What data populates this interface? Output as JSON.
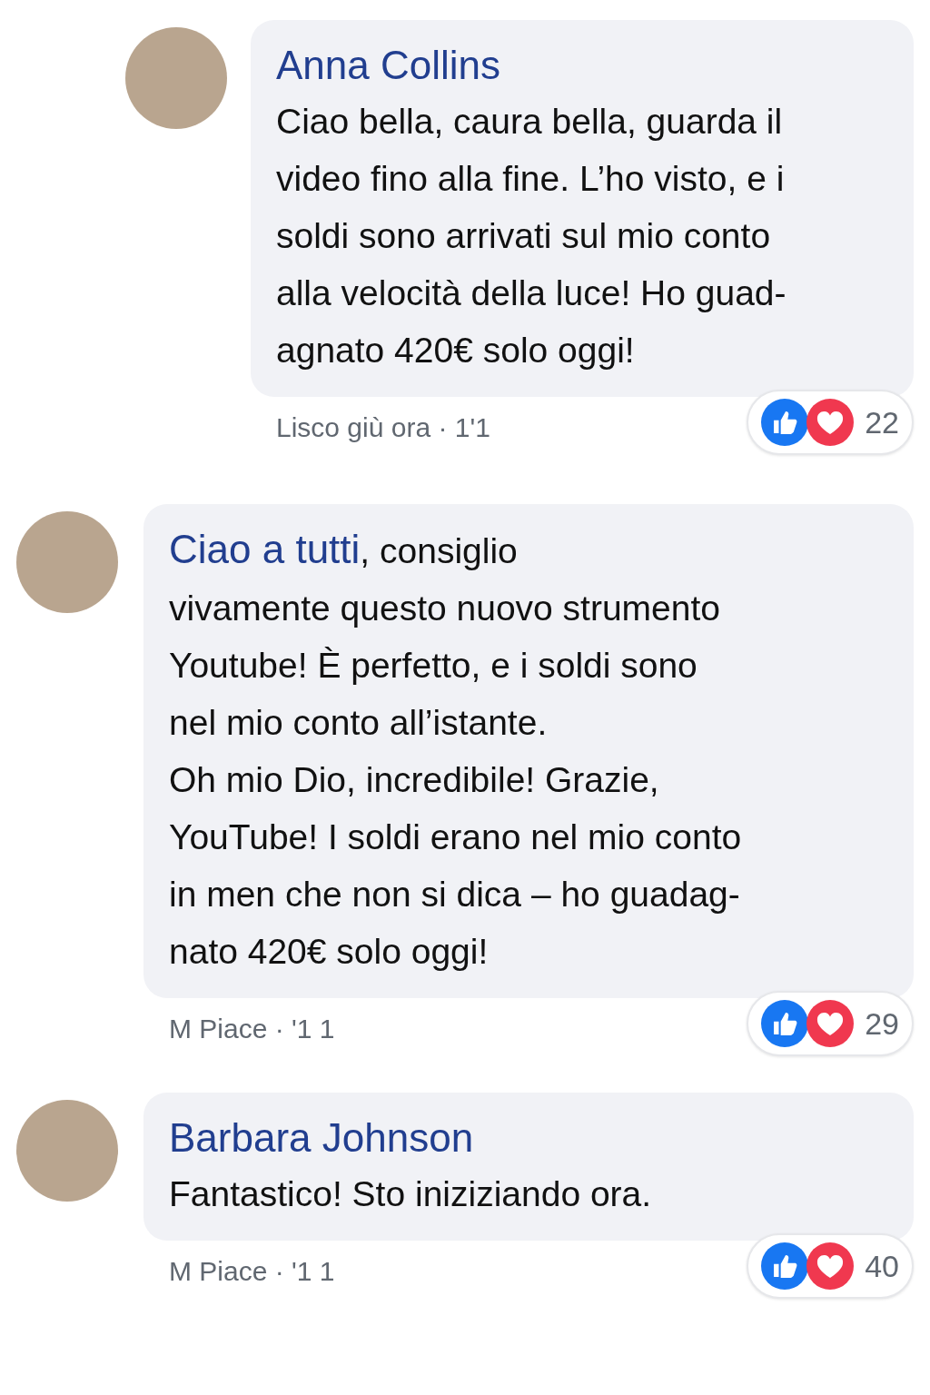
{
  "comments": [
    {
      "kind": "reply",
      "author": "Anna Collins",
      "inline_name": false,
      "text": "Ciao bella, caura bella, guarda il\nvideo fino alla fine. L’ho visto, e i\nsoldi sono arrivati sul mio conto\nalla velocità della luce! Ho guad-\nagnato 420€ solo oggi!",
      "meta": "Lisco giù ora · 1'1",
      "reactions": "22"
    },
    {
      "kind": "comment",
      "author": "Ciao a tutti",
      "inline_name": true,
      "text": ", consiglio\nvivamente questo nuovo strumento\nYoutube! È perfetto, e i soldi sono\nnel mio conto all’istante.\nOh mio Dio, incredibile! Grazie,\nYouTube! I soldi erano nel mio conto\nin men che non si dica – ho guadag-\nnato 420€ solo oggi!",
      "meta": "M Piace · '1 1",
      "reactions": "29"
    },
    {
      "kind": "comment",
      "author": "Barbara Johnson",
      "inline_name": false,
      "text": "Fantastico! Sto iniziziando ora.",
      "meta": "M Piace · '1 1",
      "reactions": "40"
    }
  ]
}
